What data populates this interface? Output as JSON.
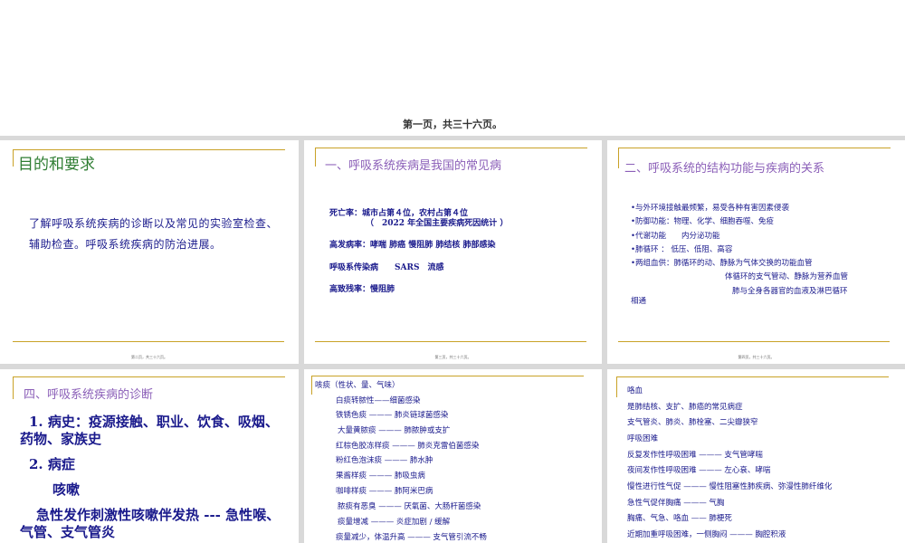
{
  "top_caption": "第一页，共三十六页。",
  "slide1": {
    "title": "目的和要求",
    "lines": [
      "了解呼吸系统疾病的诊断以及常见的实验室检查、",
      "辅助检查。呼吸系统疾病的防治进展。"
    ],
    "footer": "第二页，共三十六页。"
  },
  "slide2": {
    "title": "一、呼吸系统疾病是我国的常见病",
    "lines": [
      "死亡率：城市占第４位，农村占第４位",
      "（　2022 年全国主要疾病死因统计 ）",
      "高发病率：哮喘  肺癌  慢阻肺  肺结核  肺部感染",
      "呼吸系传染病　　SARS　流感",
      "高致残率：慢阻肺"
    ],
    "footer": "第三页，共三十六页。"
  },
  "slide3": {
    "title": "二、呼吸系统的结构功能与疾病的关系",
    "lines": [
      "•与外环境接触最频繁，易受各种有害因素侵袭",
      "•防御功能：物理、化学、细胞吞噬、免疫",
      "•代谢功能　　内分泌功能",
      "•肺循环 ：  低压、低阻、高容",
      "•两组血供：肺循环的动、静脉为气体交换的功能血管",
      "体循环的支气管动、静脉为营养血管",
      "肺与全身各器官的血液及淋巴循环",
      "相通"
    ],
    "footer": "第四页，共三十六页。"
  },
  "slide4": {
    "title": "四、呼吸系统疾病的诊断",
    "lines": [
      "1. 病史：疫源接触、职业、饮食、吸烟、",
      "药物、家族史",
      "2. 病症",
      "咳嗽",
      "急性发作刺激性咳嗽伴发热 --- 急性喉、",
      "气管、支气管炎"
    ]
  },
  "slide5": {
    "title": "咳痰（性状、量、气味）",
    "lines": [
      "白痰转脓性——细菌感染",
      "铁锈色痰 ——— 肺炎链球菌感染",
      "大量黄脓痰 ——— 肺脓肿或支扩",
      "红棕色胶冻样痰 ——— 肺炎克雷伯菌感染",
      "粉红色泡沫痰 ——— 肺水肿",
      "果酱样痰 ——— 肺吸虫病",
      "咖啡样痰 ——— 肺阿米巴病",
      "脓痰有恶臭 ——— 厌氧菌、大肠杆菌感染",
      "痰量增减 ——— 炎症加剧 / 缓解",
      "痰量减少，体温升高 ——— 支气管引流不畅"
    ]
  },
  "slide6": {
    "title": "咯血",
    "lines": [
      "是肺结核、支扩、肺癌的常见病症",
      "支气管炎、肺炎、肺栓塞、二尖瓣狭窄",
      "呼吸困难",
      "反复发作性呼吸困难 ——— 支气管哮喘",
      "夜间发作性呼吸困难 ——— 左心衰、哮喘",
      "慢性进行性气促 ——— 慢性阻塞性肺疾病、弥漫性肺纤维化",
      "急性气促伴胸痛 ——— 气胸",
      "胸痛、气急、咯血 —— 肺梗死",
      "近期加重呼吸困难，一侧胸闷 ——— 胸腔积液"
    ]
  }
}
